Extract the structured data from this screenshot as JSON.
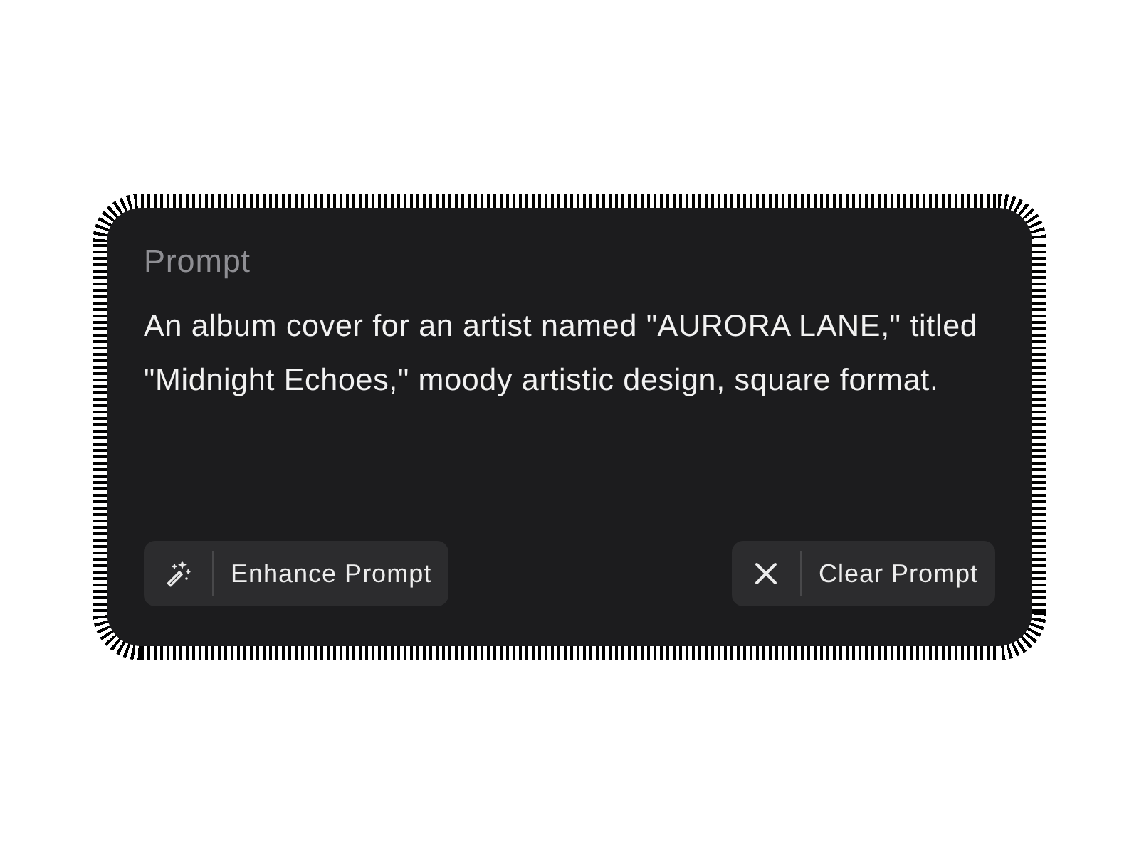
{
  "prompt": {
    "label": "Prompt",
    "value": "An album cover for an artist named \"AURORA LANE,\" titled \"Midnight Echoes,\" moody artistic design, square format."
  },
  "buttons": [
    {
      "kind": "enhance",
      "label": "Enhance Prompt"
    },
    {
      "kind": "clear",
      "label": "Clear Prompt"
    }
  ]
}
